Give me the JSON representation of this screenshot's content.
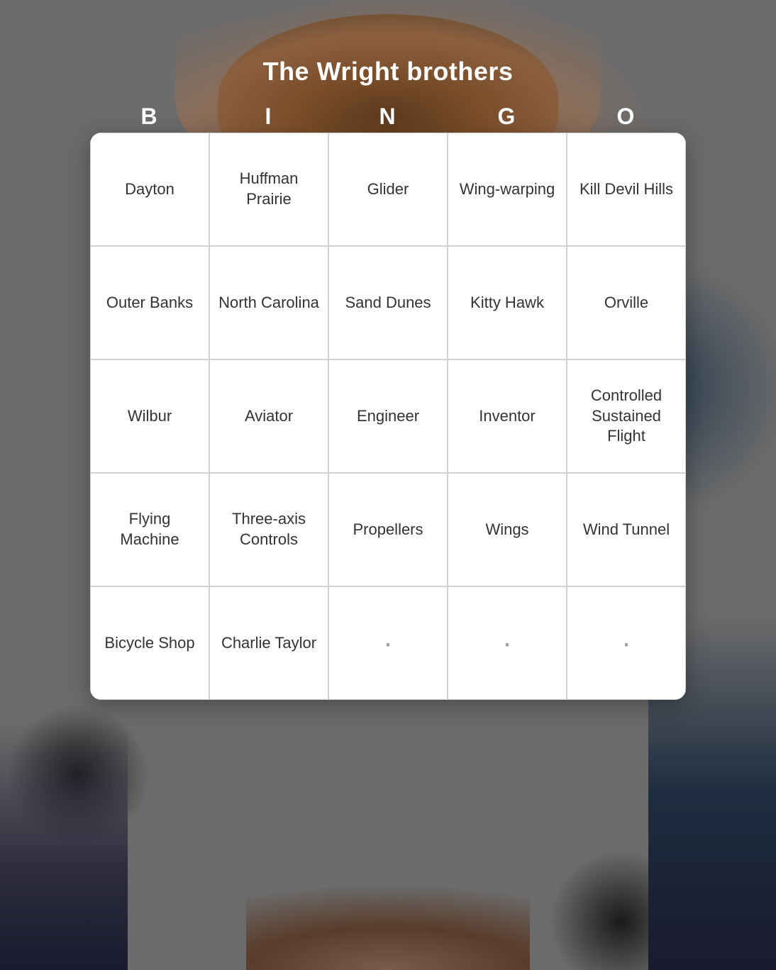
{
  "title": "The Wright brothers",
  "bingo_letters": [
    "B",
    "I",
    "N",
    "G",
    "O"
  ],
  "cells": [
    [
      "Dayton",
      "Huffman Prairie",
      "Glider",
      "Wing-warping",
      "Kill Devil Hills"
    ],
    [
      "Outer Banks",
      "North Carolina",
      "Sand Dunes",
      "Kitty Hawk",
      "Orville"
    ],
    [
      "Wilbur",
      "Aviator",
      "Engineer",
      "Inventor",
      "Controlled Sustained Flight"
    ],
    [
      "Flying Machine",
      "Three-axis Controls",
      "Propellers",
      "Wings",
      "Wind Tunnel"
    ],
    [
      "Bicycle Shop",
      "Charlie Taylor",
      "·",
      "·",
      "·"
    ]
  ]
}
